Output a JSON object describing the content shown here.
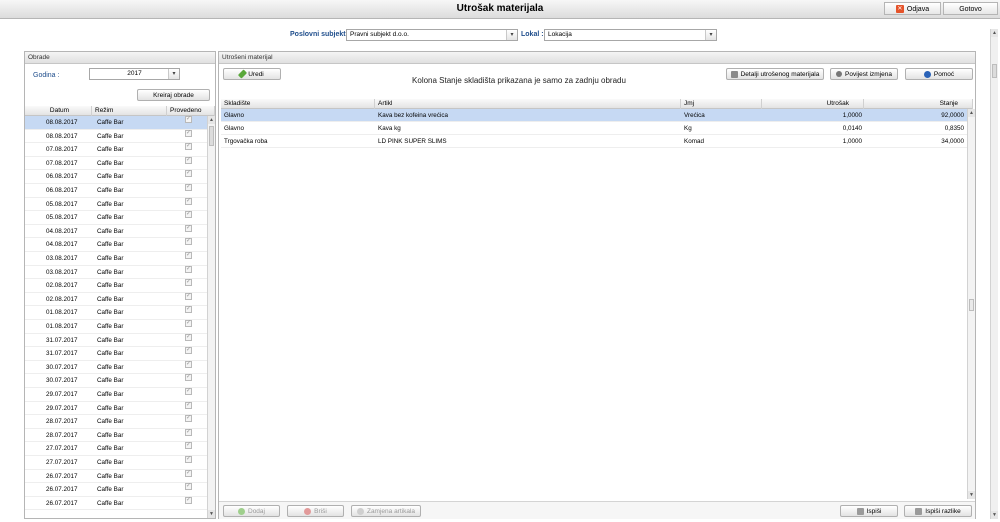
{
  "header": {
    "title": "Utrošak materijala",
    "odjava_label": "Odjava",
    "gotovo_label": "Gotovo"
  },
  "filters": {
    "poslovni_subjekt_label": "Poslovni subjekt :",
    "poslovni_subjekt_value": "Pravni subjekt d.o.o.",
    "lokal_label": "Lokal :",
    "lokal_value": "Lokacija"
  },
  "obrade": {
    "panel_title": "Obrade",
    "godina_label": "Godina :",
    "godina_value": "2017",
    "kreiraj_label": "Kreiraj obrade",
    "columns": [
      "Datum",
      "Režim",
      "Provedeno"
    ],
    "rows": [
      {
        "datum": "08.08.2017",
        "rezim": "Caffe Bar",
        "provedeno": true
      },
      {
        "datum": "08.08.2017",
        "rezim": "Caffe Bar",
        "provedeno": true
      },
      {
        "datum": "07.08.2017",
        "rezim": "Caffe Bar",
        "provedeno": true
      },
      {
        "datum": "07.08.2017",
        "rezim": "Caffe Bar",
        "provedeno": true
      },
      {
        "datum": "06.08.2017",
        "rezim": "Caffe Bar",
        "provedeno": true
      },
      {
        "datum": "06.08.2017",
        "rezim": "Caffe Bar",
        "provedeno": true
      },
      {
        "datum": "05.08.2017",
        "rezim": "Caffe Bar",
        "provedeno": true
      },
      {
        "datum": "05.08.2017",
        "rezim": "Caffe Bar",
        "provedeno": true
      },
      {
        "datum": "04.08.2017",
        "rezim": "Caffe Bar",
        "provedeno": true
      },
      {
        "datum": "04.08.2017",
        "rezim": "Caffe Bar",
        "provedeno": true
      },
      {
        "datum": "03.08.2017",
        "rezim": "Caffe Bar",
        "provedeno": true
      },
      {
        "datum": "03.08.2017",
        "rezim": "Caffe Bar",
        "provedeno": true
      },
      {
        "datum": "02.08.2017",
        "rezim": "Caffe Bar",
        "provedeno": true
      },
      {
        "datum": "02.08.2017",
        "rezim": "Caffe Bar",
        "provedeno": true
      },
      {
        "datum": "01.08.2017",
        "rezim": "Caffe Bar",
        "provedeno": true
      },
      {
        "datum": "01.08.2017",
        "rezim": "Caffe Bar",
        "provedeno": true
      },
      {
        "datum": "31.07.2017",
        "rezim": "Caffe Bar",
        "provedeno": true
      },
      {
        "datum": "31.07.2017",
        "rezim": "Caffe Bar",
        "provedeno": true
      },
      {
        "datum": "30.07.2017",
        "rezim": "Caffe Bar",
        "provedeno": true
      },
      {
        "datum": "30.07.2017",
        "rezim": "Caffe Bar",
        "provedeno": true
      },
      {
        "datum": "29.07.2017",
        "rezim": "Caffe Bar",
        "provedeno": true
      },
      {
        "datum": "29.07.2017",
        "rezim": "Caffe Bar",
        "provedeno": true
      },
      {
        "datum": "28.07.2017",
        "rezim": "Caffe Bar",
        "provedeno": true
      },
      {
        "datum": "28.07.2017",
        "rezim": "Caffe Bar",
        "provedeno": true
      },
      {
        "datum": "27.07.2017",
        "rezim": "Caffe Bar",
        "provedeno": true
      },
      {
        "datum": "27.07.2017",
        "rezim": "Caffe Bar",
        "provedeno": true
      },
      {
        "datum": "26.07.2017",
        "rezim": "Caffe Bar",
        "provedeno": true
      },
      {
        "datum": "26.07.2017",
        "rezim": "Caffe Bar",
        "provedeno": true
      },
      {
        "datum": "26.07.2017",
        "rezim": "Caffe Bar",
        "provedeno": true
      }
    ]
  },
  "utroseni": {
    "panel_title": "Utrošeni materijal",
    "uredi_label": "Uredi",
    "notice": "Kolona Stanje skladišta prikazana je samo za zadnju obradu",
    "detalji_label": "Detalji utrošenog materijala",
    "povijest_label": "Povijest izmjena",
    "pomoc_label": "Pomoć",
    "columns": [
      "Skladište",
      "Artikl",
      "Jmj",
      "Utrošak",
      "Stanje"
    ],
    "rows": [
      {
        "skladiste": "Glavno",
        "artikl": "Kava bez kofeina vrećica",
        "jmj": "Vrećica",
        "utrosak": "1,0000",
        "stanje": "92,0000"
      },
      {
        "skladiste": "Glavno",
        "artikl": "Kava kg",
        "jmj": "Kg",
        "utrosak": "0,0140",
        "stanje": "0,8350"
      },
      {
        "skladiste": "Trgovačka roba",
        "artikl": "LD PINK SUPER SLIMS",
        "jmj": "Komad",
        "utrosak": "1,0000",
        "stanje": "34,0000"
      }
    ],
    "dodaj_label": "Dodaj",
    "brisi_label": "Briši",
    "zamjena_label": "Zamjena artikala",
    "ispisi_label": "Ispiši",
    "ispisi_razlike_label": "Ispiši razlike"
  },
  "colors": {
    "label_blue": "#1f4e8c",
    "selected_row": "#c6d9f3",
    "odjava_red": "#e5532a",
    "help_blue": "#2a63b8",
    "uredi_green": "#5aa83a"
  }
}
